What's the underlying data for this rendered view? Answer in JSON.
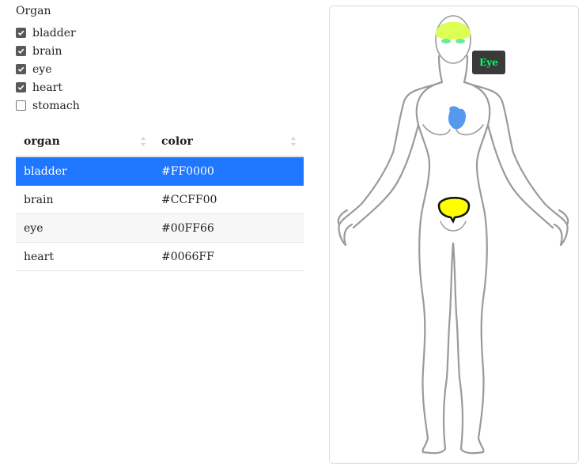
{
  "filter": {
    "title": "Organ",
    "options": [
      {
        "label": "bladder",
        "checked": true
      },
      {
        "label": "brain",
        "checked": true
      },
      {
        "label": "eye",
        "checked": true
      },
      {
        "label": "heart",
        "checked": true
      },
      {
        "label": "stomach",
        "checked": false
      }
    ]
  },
  "table": {
    "columns": [
      "organ",
      "color"
    ],
    "rows": [
      {
        "organ": "bladder",
        "color": "#FF0000",
        "selected": true
      },
      {
        "organ": "brain",
        "color": "#CCFF00"
      },
      {
        "organ": "eye",
        "color": "#00FF66"
      },
      {
        "organ": "heart",
        "color": "#0066FF"
      }
    ]
  },
  "body_map": {
    "tooltip": "Eye",
    "tooltip_color": "#00FF66",
    "highlight_colors": {
      "brain": "#DDFF55",
      "eye": "#66EE99",
      "heart": "#5599EE",
      "bladder": "#FFFF00"
    }
  }
}
